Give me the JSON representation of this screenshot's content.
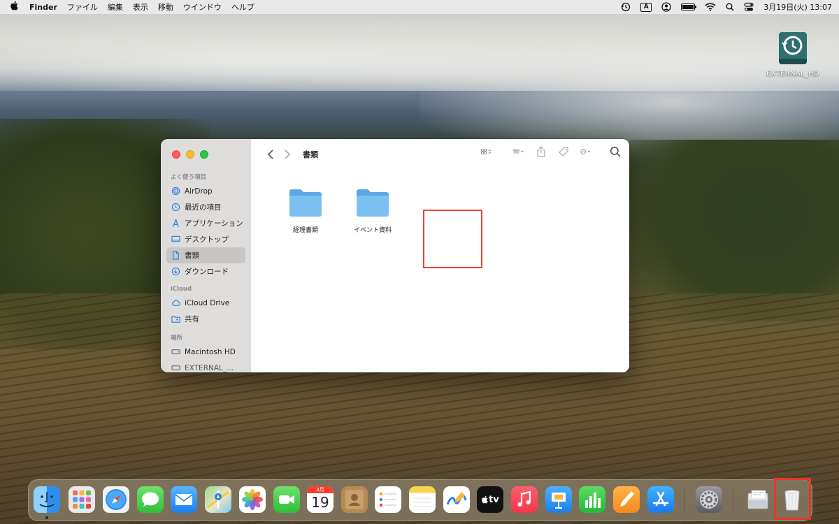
{
  "menubar": {
    "apple_icon": "apple-logo-icon",
    "items": [
      "Finder",
      "ファイル",
      "編集",
      "表示",
      "移動",
      "ウインドウ",
      "ヘルプ"
    ],
    "input_source": "A",
    "clock": "3月19日(火)  13:07"
  },
  "desktop": {
    "external_drive_label": "EXTERNAL_HD"
  },
  "finder": {
    "title": "書類",
    "sidebar": {
      "favorites_header": "よく使う項目",
      "favorites": [
        {
          "label": "AirDrop",
          "icon": "airdrop-icon"
        },
        {
          "label": "最近の項目",
          "icon": "clock-icon"
        },
        {
          "label": "アプリケーション",
          "icon": "applications-icon"
        },
        {
          "label": "デスクトップ",
          "icon": "desktop-icon"
        },
        {
          "label": "書類",
          "icon": "document-icon",
          "selected": true
        },
        {
          "label": "ダウンロード",
          "icon": "download-icon"
        }
      ],
      "icloud_header": "iCloud",
      "icloud": [
        {
          "label": "iCloud Drive",
          "icon": "cloud-icon"
        },
        {
          "label": "共有",
          "icon": "shared-folder-icon"
        }
      ],
      "locations_header": "場所",
      "locations": [
        {
          "label": "Macintosh HD",
          "icon": "hard-drive-icon"
        },
        {
          "label": "EXTERNAL_...",
          "icon": "external-drive-icon"
        }
      ]
    },
    "files": [
      {
        "name": "経理書類",
        "icon": "folder-icon"
      },
      {
        "name": "イベント資料",
        "icon": "folder-icon"
      }
    ]
  },
  "dock": {
    "apps": [
      "Finder",
      "Launchpad",
      "Safari",
      "Messages",
      "Mail",
      "Maps",
      "Photos",
      "FaceTime",
      "Calendar",
      "Contacts",
      "Reminders",
      "Notes",
      "Freeform",
      "TV",
      "Music",
      "Keynote",
      "Numbers",
      "Pages",
      "App Store",
      "System Settings",
      "Preview",
      "Trash"
    ],
    "calendar_month": "3月",
    "calendar_day": "19",
    "tv_label": "tv"
  }
}
